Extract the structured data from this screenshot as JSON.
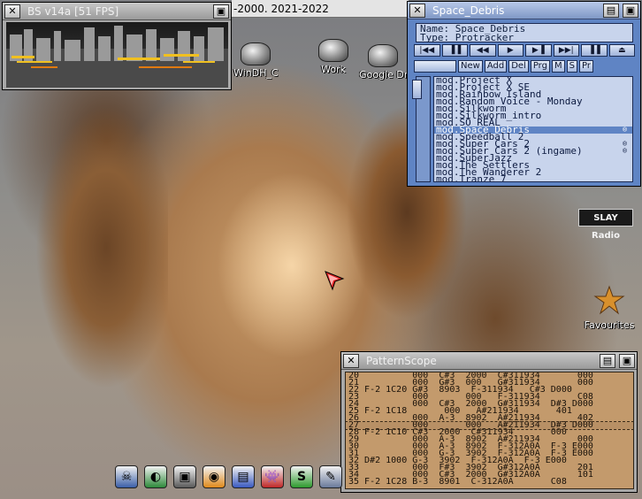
{
  "workbench": {
    "title": "-2000. 2021-2022"
  },
  "bs_window": {
    "title": "BS v14a [51 FPS]"
  },
  "player_window": {
    "title": "Space_Debris",
    "name_label": "Name: Space_Debris",
    "type_label": "Type: Protracker",
    "transport": [
      "|◀◀",
      "▐▐",
      "◀◀",
      "▶",
      "▶▐",
      "▶▶|",
      "▐▐",
      "⏏"
    ],
    "tools": [
      "New",
      "Add",
      "Del",
      "Prg",
      "M",
      "S",
      "Pr"
    ],
    "playlist": [
      {
        "name": "mod.Project X",
        "mark": ""
      },
      {
        "name": "mod.Project X SE",
        "mark": ""
      },
      {
        "name": "mod.Rainbow Island",
        "mark": ""
      },
      {
        "name": "mod.Random Voice - Monday",
        "mark": ""
      },
      {
        "name": "mod.Silkworm",
        "mark": ""
      },
      {
        "name": "mod.Silkworm_intro",
        "mark": ""
      },
      {
        "name": "mod.SO_REAL",
        "mark": ""
      },
      {
        "name": "mod.Space_Debris",
        "mark": "®",
        "selected": true
      },
      {
        "name": "mod.Speedball 2",
        "mark": ""
      },
      {
        "name": "mod.Super Cars 2",
        "mark": "®"
      },
      {
        "name": "mod.Super Cars 2 (ingame)",
        "mark": "®"
      },
      {
        "name": "mod.SuperJazz",
        "mark": ""
      },
      {
        "name": "mod.The Settlers",
        "mark": ""
      },
      {
        "name": "mod.The Wanderer 2",
        "mark": ""
      },
      {
        "name": "mod.Tranze 7",
        "mark": ""
      }
    ]
  },
  "desktop_icons": [
    {
      "label": "WinDH_C"
    },
    {
      "label": "Work"
    },
    {
      "label": "Google Dr"
    }
  ],
  "slay_radio": {
    "label": "SLAY Radio"
  },
  "favourites": {
    "label": "Favourites"
  },
  "scope_window": {
    "title": "PatternScope",
    "rows": [
      "20          000  C#3  2000  C#311934       000",
      "21          000  G#3  000   G#311934       000",
      "22 F-2 1C20 G#3  8903  F-311934   C#3 D000",
      "23          000       000   F-311934       C08",
      "24          000  C#3  2000  G#311934  D#3 D000",
      "25 F-2 1C18       000   A#211934       401",
      "26          000  A-3  8902  A#211934       402",
      "27          000       000   A#211934  D#3 D000",
      "28 F-2 1C10 C#3  2000  C#311934       000",
      "29          000  A-3  8902  A#211934       000",
      "30          000  A-3  8902  F-312A0A  F-3 E000",
      "31          000  G-3  3902  F-312A0A  F-3 E000",
      "32 D#2 1000 G-3  3902  F-312A0A  F-3 E000",
      "33          000  F#3  3902  G#312A0A       201",
      "34          000  C#3  2000  G#312A0A       101",
      "35 F-2 1C28 B-3  8901  C-312A0A       C08"
    ]
  },
  "dock": [
    {
      "icon": "skull-icon",
      "glyph": "☠",
      "color": "#3b5fa8"
    },
    {
      "icon": "globe-icon",
      "glyph": "◐",
      "color": "#2e8a3a"
    },
    {
      "icon": "camera-icon",
      "glyph": "▣",
      "color": "#5a5a5a"
    },
    {
      "icon": "cd-icon",
      "glyph": "◉",
      "color": "#e08a1c"
    },
    {
      "icon": "drive-icon",
      "glyph": "▤",
      "color": "#3a5ac0"
    },
    {
      "icon": "invader-icon",
      "glyph": "👾",
      "color": "#c02828"
    },
    {
      "icon": "snake-icon",
      "glyph": "S",
      "color": "#2e9a2e"
    },
    {
      "icon": "tool-icon",
      "glyph": "✎",
      "color": "#6a7a9a"
    }
  ]
}
